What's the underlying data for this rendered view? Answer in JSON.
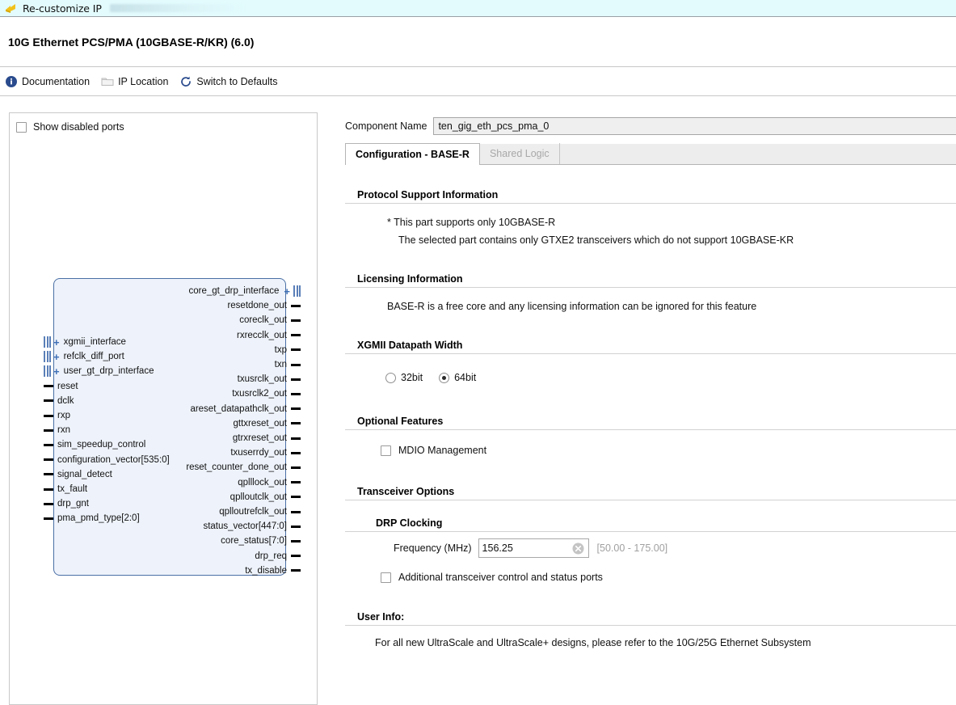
{
  "window": {
    "title": "Re-customize IP",
    "icon": "ip-customize-icon"
  },
  "header": {
    "page_title": "10G Ethernet PCS/PMA (10GBASE-R/KR) (6.0)"
  },
  "toolbar": {
    "items": [
      {
        "label": "Documentation",
        "icon": "info-icon"
      },
      {
        "label": "IP Location",
        "icon": "folder-icon"
      },
      {
        "label": "Switch to Defaults",
        "icon": "refresh-icon"
      }
    ]
  },
  "left_panel": {
    "show_disabled_ports": {
      "label": "Show disabled ports",
      "checked": false
    },
    "diagram": {
      "left_ports": [
        {
          "name": "xgmii_interface",
          "type": "bus",
          "expandable": true
        },
        {
          "name": "refclk_diff_port",
          "type": "bus",
          "expandable": true
        },
        {
          "name": "user_gt_drp_interface",
          "type": "bus",
          "expandable": true
        },
        {
          "name": "reset",
          "type": "pin",
          "expandable": false
        },
        {
          "name": "dclk",
          "type": "pin",
          "expandable": false
        },
        {
          "name": "rxp",
          "type": "pin",
          "expandable": false
        },
        {
          "name": "rxn",
          "type": "pin",
          "expandable": false
        },
        {
          "name": "sim_speedup_control",
          "type": "pin",
          "expandable": false
        },
        {
          "name": "configuration_vector[535:0]",
          "type": "pin",
          "expandable": false
        },
        {
          "name": "signal_detect",
          "type": "pin",
          "expandable": false
        },
        {
          "name": "tx_fault",
          "type": "pin",
          "expandable": false
        },
        {
          "name": "drp_gnt",
          "type": "pin",
          "expandable": false
        },
        {
          "name": "pma_pmd_type[2:0]",
          "type": "pin",
          "expandable": false
        }
      ],
      "right_ports": [
        {
          "name": "core_gt_drp_interface",
          "type": "bus",
          "expandable": true
        },
        {
          "name": "resetdone_out",
          "type": "pin",
          "expandable": false
        },
        {
          "name": "coreclk_out",
          "type": "pin",
          "expandable": false
        },
        {
          "name": "rxrecclk_out",
          "type": "pin",
          "expandable": false
        },
        {
          "name": "txp",
          "type": "pin",
          "expandable": false
        },
        {
          "name": "txn",
          "type": "pin",
          "expandable": false
        },
        {
          "name": "txusrclk_out",
          "type": "pin",
          "expandable": false
        },
        {
          "name": "txusrclk2_out",
          "type": "pin",
          "expandable": false
        },
        {
          "name": "areset_datapathclk_out",
          "type": "pin",
          "expandable": false
        },
        {
          "name": "gttxreset_out",
          "type": "pin",
          "expandable": false
        },
        {
          "name": "gtrxreset_out",
          "type": "pin",
          "expandable": false
        },
        {
          "name": "txuserrdy_out",
          "type": "pin",
          "expandable": false
        },
        {
          "name": "reset_counter_done_out",
          "type": "pin",
          "expandable": false
        },
        {
          "name": "qplllock_out",
          "type": "pin",
          "expandable": false
        },
        {
          "name": "qplloutclk_out",
          "type": "pin",
          "expandable": false
        },
        {
          "name": "qplloutrefclk_out",
          "type": "pin",
          "expandable": false
        },
        {
          "name": "status_vector[447:0]",
          "type": "pin",
          "expandable": false
        },
        {
          "name": "core_status[7:0]",
          "type": "pin",
          "expandable": false
        },
        {
          "name": "drp_req",
          "type": "pin",
          "expandable": false
        },
        {
          "name": "tx_disable",
          "type": "pin",
          "expandable": false
        }
      ]
    }
  },
  "right_panel": {
    "component_name": {
      "label": "Component Name",
      "value": "ten_gig_eth_pcs_pma_0"
    },
    "tabs": [
      {
        "label": "Configuration - BASE-R",
        "active": true,
        "disabled": false
      },
      {
        "label": "Shared Logic",
        "active": false,
        "disabled": true
      }
    ],
    "sections": {
      "protocol_support": {
        "title": "Protocol Support Information",
        "line1": "* This part supports only 10GBASE-R",
        "line2": "The selected part contains only GTXE2 transceivers which do not support 10GBASE-KR"
      },
      "licensing": {
        "title": "Licensing Information",
        "line1": "BASE-R is a free core and any licensing information can be ignored for this feature"
      },
      "xgmii_datapath_width": {
        "title": "XGMII Datapath Width",
        "options": [
          {
            "label": "32bit",
            "selected": false
          },
          {
            "label": "64bit",
            "selected": true
          }
        ]
      },
      "optional_features": {
        "title": "Optional Features",
        "checkboxes": [
          {
            "label": "MDIO Management",
            "checked": false
          }
        ]
      },
      "transceiver_options": {
        "title": "Transceiver Options",
        "drp_clocking": {
          "title": "DRP Clocking",
          "frequency_label": "Frequency (MHz)",
          "frequency_value": "156.25",
          "frequency_range": "[50.00 - 175.00]"
        },
        "checkboxes": [
          {
            "label": "Additional transceiver control and status ports",
            "checked": false
          }
        ]
      },
      "user_info": {
        "title": "User Info:",
        "line1": "For all new UltraScale and UltraScale+ designs, please refer to the 10G/25G Ethernet Subsystem"
      }
    }
  },
  "colors": {
    "titlebar_bg": "#e3fbfd",
    "block_fill": "#eef3fb",
    "block_border": "#4a6fa5",
    "accent_blue": "#3e6fb5",
    "hint_gray": "#a0a0a0"
  }
}
